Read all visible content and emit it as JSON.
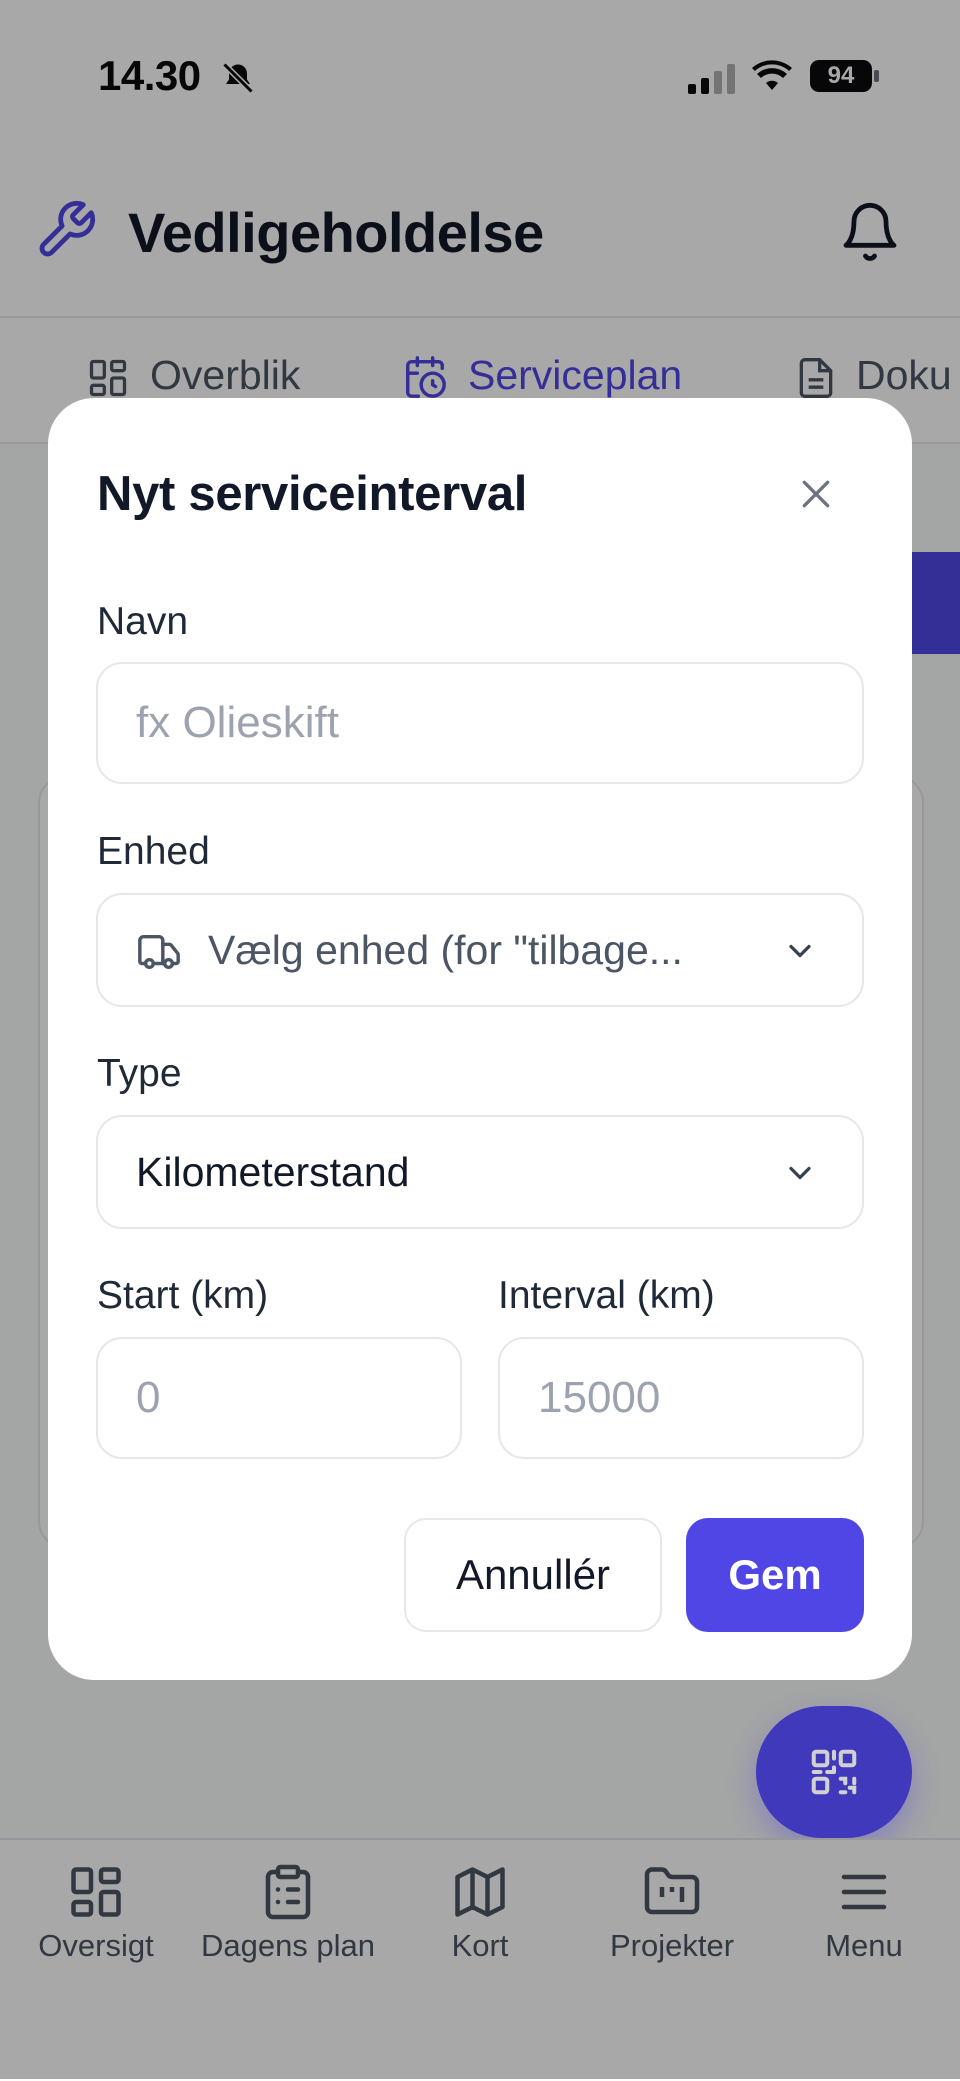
{
  "status_bar": {
    "time": "14.30",
    "battery": "94"
  },
  "header": {
    "title": "Vedligeholdelse"
  },
  "tabs": [
    {
      "label": "Overblik"
    },
    {
      "label": "Serviceplan"
    },
    {
      "label": "Doku"
    }
  ],
  "modal": {
    "title": "Nyt serviceinterval",
    "name_label": "Navn",
    "name_placeholder": "fx Olieskift",
    "unit_label": "Enhed",
    "unit_select_text": "Vælg enhed (for \"tilbage...",
    "type_label": "Type",
    "type_value": "Kilometerstand",
    "start_label": "Start (km)",
    "start_placeholder": "0",
    "interval_label": "Interval (km)",
    "interval_placeholder": "15000",
    "cancel_label": "Annullér",
    "save_label": "Gem"
  },
  "bottom_nav": [
    {
      "label": "Oversigt",
      "icon": "dashboard-icon"
    },
    {
      "label": "Dagens plan",
      "icon": "clipboard-icon"
    },
    {
      "label": "Kort",
      "icon": "map-icon"
    },
    {
      "label": "Projekter",
      "icon": "folder-icon"
    },
    {
      "label": "Menu",
      "icon": "menu-icon"
    }
  ],
  "colors": {
    "accent": "#4f46e5",
    "overlay": "rgba(0,0,0,0.34)"
  }
}
